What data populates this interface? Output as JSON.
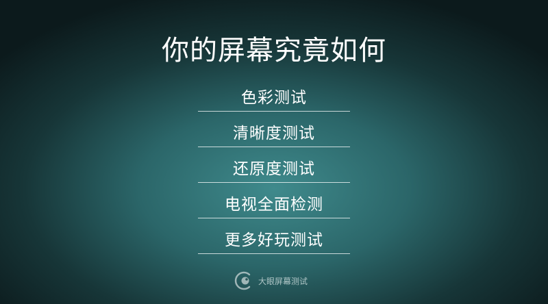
{
  "title": "你的屏幕究竟如何",
  "menu": {
    "items": [
      {
        "label": "色彩测试"
      },
      {
        "label": "清晰度测试"
      },
      {
        "label": "还原度测试"
      },
      {
        "label": "电视全面检测"
      },
      {
        "label": "更多好玩测试"
      }
    ]
  },
  "footer": {
    "logo_icon": "eye-logo-icon",
    "brand_name": "大眼屏幕测试"
  },
  "colors": {
    "background_center": "#3f8a8c",
    "background_edge": "#0c1a1c",
    "text": "#ffffff"
  }
}
